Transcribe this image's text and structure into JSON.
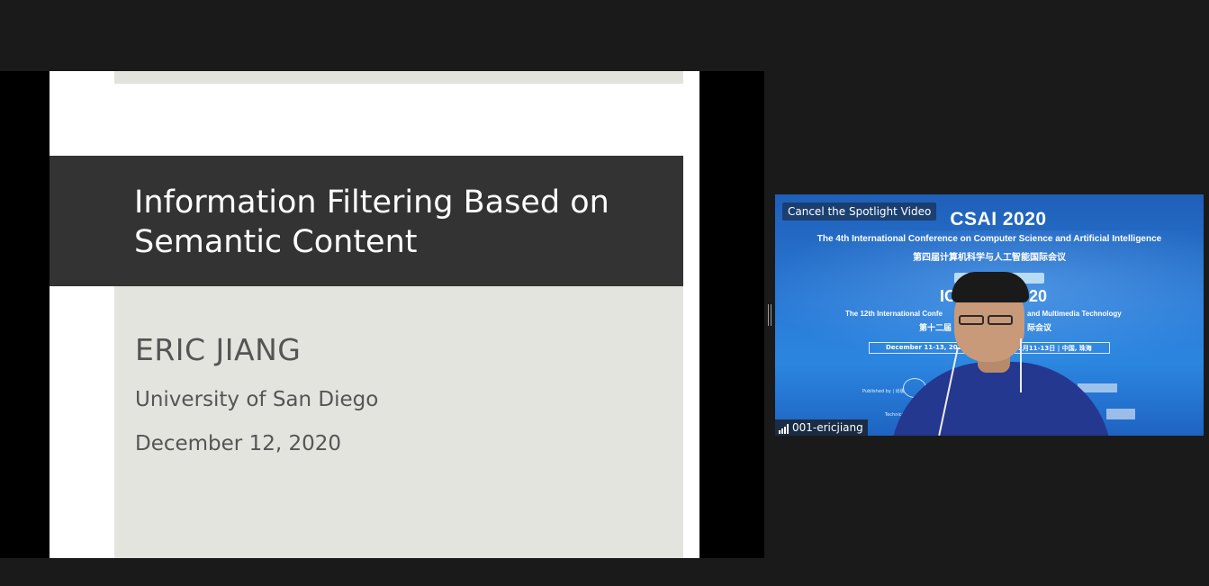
{
  "slide": {
    "title": "Information Filtering Based on Semantic Content",
    "author": "ERIC JIANG",
    "affiliation": "University of San Diego",
    "date": "December 12, 2020"
  },
  "video": {
    "spotlight_button": "Cancel the Spotlight Video",
    "participant_name": "001-ericjiang",
    "signal_icon": "signal-strength-icon",
    "background_banner": {
      "title": "CSAI 2020",
      "subtitle": "The 4th International Conference on Computer Science and Artificial Intelligence",
      "chinese_title": "第四届计算机科学与人工智能国际会议",
      "logo_left": "IC",
      "logo_right": "20",
      "conf_line_left": "The 12th International Confe",
      "conf_line_right": "and Multimedia Technology",
      "chinese_line_left": "第十二届",
      "chinese_line_right": "际会议",
      "date_left": "December 11-13, 2020",
      "date_right": "2月11-13日 | 中国, 珠海",
      "small_text_1": "Published by | 出版",
      "small_text_2": "Technical Sponsored by | 技术支"
    }
  },
  "colors": {
    "app_background": "#1a1a1a",
    "slide_title_band": "#333333",
    "slide_body_band": "#e4e4df",
    "video_blue": "#2a7ad6"
  }
}
